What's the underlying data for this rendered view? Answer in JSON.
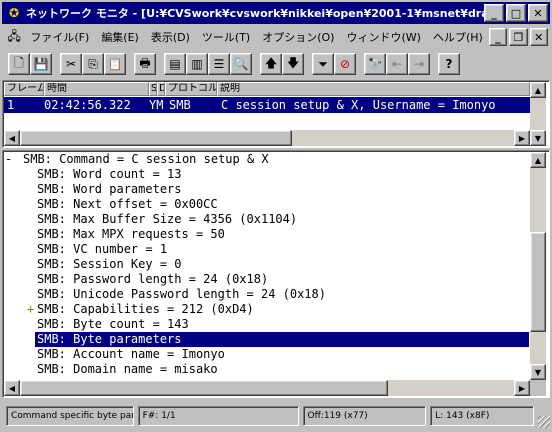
{
  "window": {
    "title": "ネットワーク モニタ - [U:¥CVSwork¥cvswork¥nikkei¥open¥2001-1¥msnet¥drafts¥captures¥yu..."
  },
  "menu": {
    "items": [
      "ファイル(F)",
      "編集(E)",
      "表示(D)",
      "ツール(T)",
      "オプション(O)",
      "ウィンドウ(W)",
      "ヘルプ(H)"
    ]
  },
  "toolbar": {
    "buttons": [
      "new-icon",
      "save-icon",
      "cut-icon",
      "copy-icon",
      "paste-icon",
      "print-icon",
      "pane-summary-icon",
      "pane-detail-icon",
      "pane-hex-icon",
      "zoom-icon",
      "up-arrow-icon",
      "down-arrow-icon",
      "filter-icon",
      "filter-off-icon",
      "find-icon",
      "find-prev-icon",
      "find-next-icon",
      "help-icon"
    ]
  },
  "summary": {
    "columns": [
      "フレーム",
      "時間",
      "S",
      "D",
      "プロトコル",
      "説明"
    ],
    "selected_row": {
      "frame": "1",
      "time": "02:42:56.322",
      "src": "YM",
      "protocol": "SMB",
      "description": "C session setup & X, Username = Imonyo"
    }
  },
  "detail": {
    "lines": [
      {
        "prefix": "-",
        "text": "SMB: Command = C session setup & X",
        "indent": 0,
        "selected": false
      },
      {
        "prefix": "",
        "text": "SMB: Word count = 13",
        "indent": 1,
        "selected": false
      },
      {
        "prefix": "",
        "text": "SMB: Word parameters",
        "indent": 1,
        "selected": false
      },
      {
        "prefix": "",
        "text": "SMB: Next offset = 0x00CC",
        "indent": 1,
        "selected": false
      },
      {
        "prefix": "",
        "text": "SMB: Max Buffer Size = 4356 (0x1104)",
        "indent": 1,
        "selected": false
      },
      {
        "prefix": "",
        "text": "SMB: Max MPX requests = 50",
        "indent": 1,
        "selected": false
      },
      {
        "prefix": "",
        "text": "SMB: VC number = 1",
        "indent": 1,
        "selected": false
      },
      {
        "prefix": "",
        "text": "SMB: Session Key = 0",
        "indent": 1,
        "selected": false
      },
      {
        "prefix": "",
        "text": "SMB: Password length = 24 (0x18)",
        "indent": 1,
        "selected": false
      },
      {
        "prefix": "",
        "text": "SMB: Unicode Password length = 24 (0x18)",
        "indent": 1,
        "selected": false
      },
      {
        "prefix": "+",
        "text": "SMB: Capabilities = 212 (0xD4)",
        "indent": 1,
        "selected": false
      },
      {
        "prefix": "",
        "text": "SMB: Byte count = 143",
        "indent": 1,
        "selected": false
      },
      {
        "prefix": "",
        "text": "SMB: Byte parameters",
        "indent": 1,
        "selected": true
      },
      {
        "prefix": "",
        "text": "SMB: Account name = Imonyo",
        "indent": 1,
        "selected": false
      },
      {
        "prefix": "",
        "text": "SMB: Domain name = misako",
        "indent": 1,
        "selected": false
      }
    ]
  },
  "status": {
    "hint": "Command specific byte par",
    "frame": "F#: 1/1",
    "offset": "Off:119 (x77)",
    "length": "L: 143 (x8F)"
  }
}
